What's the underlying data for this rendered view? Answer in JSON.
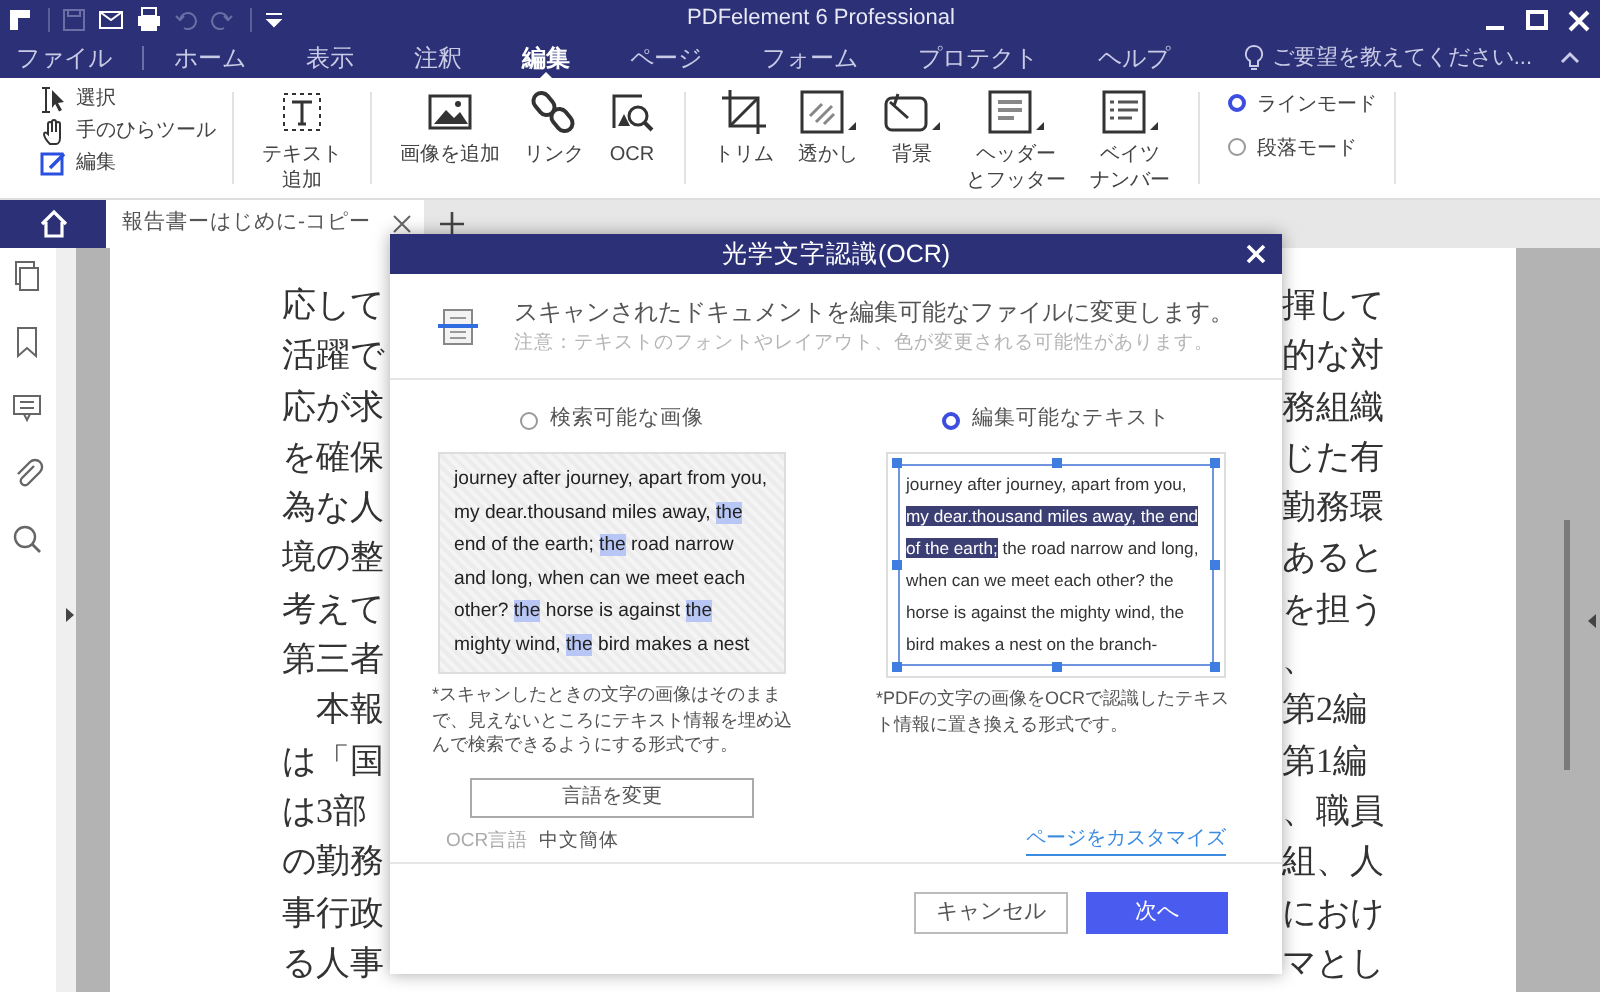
{
  "window": {
    "title": "PDFelement 6 Professional"
  },
  "quick_access": [
    {
      "kind": "logo",
      "disabled": false
    },
    {
      "kind": "save",
      "disabled": true
    },
    {
      "kind": "mail",
      "disabled": false
    },
    {
      "kind": "print",
      "disabled": false
    },
    {
      "kind": "undo",
      "disabled": true
    },
    {
      "kind": "redo",
      "disabled": true
    },
    {
      "kind": "customize",
      "disabled": false
    }
  ],
  "menu": {
    "tabs": [
      {
        "label": "ファイル",
        "selected": false
      },
      {
        "label": "ホーム",
        "selected": false
      },
      {
        "label": "表示",
        "selected": false
      },
      {
        "label": "注釈",
        "selected": false
      },
      {
        "label": "編集",
        "selected": true
      },
      {
        "label": "ページ",
        "selected": false
      },
      {
        "label": "フォーム",
        "selected": false
      },
      {
        "label": "プロテクト",
        "selected": false
      },
      {
        "label": "ヘルプ",
        "selected": false
      }
    ],
    "help_prompt": "ご要望を教えてください..."
  },
  "ribbon": {
    "select_tools": [
      {
        "label": "選択",
        "kind": "select"
      },
      {
        "label": "手のひらツール",
        "kind": "hand"
      },
      {
        "label": "編集",
        "kind": "edit"
      }
    ],
    "tools": [
      {
        "label_lines": [
          "テキスト",
          "追加"
        ],
        "kind": "text",
        "dropdown": false
      },
      {
        "label": "画像を追加",
        "kind": "image",
        "dropdown": false
      },
      {
        "label": "リンク",
        "kind": "link",
        "dropdown": false
      },
      {
        "label": "OCR",
        "kind": "ocr",
        "dropdown": false
      },
      {
        "label": "トリム",
        "kind": "crop",
        "dropdown": false
      },
      {
        "label": "透かし",
        "kind": "watermark",
        "dropdown": true
      },
      {
        "label": "背景",
        "kind": "background",
        "dropdown": true
      },
      {
        "label_lines": [
          "ヘッダー",
          "とフッター"
        ],
        "kind": "header",
        "dropdown": true
      },
      {
        "label_lines": [
          "ベイツ",
          "ナンバー"
        ],
        "kind": "bates",
        "dropdown": true
      }
    ],
    "modes": [
      {
        "label": "ラインモード",
        "selected": true
      },
      {
        "label": "段落モード",
        "selected": false
      }
    ]
  },
  "doc_tabs": [
    {
      "label": "報告書ーはじめに-コピー",
      "selected": true
    }
  ],
  "document": {
    "lines": [
      {
        "left": "応して",
        "right": "揮して"
      },
      {
        "left": "活躍で",
        "right": "的な対"
      },
      {
        "left": "応が求",
        "right": "務組織"
      },
      {
        "left": "を確保",
        "right": "じた有"
      },
      {
        "left": "為な人",
        "right": "勤務環"
      },
      {
        "left": "境の整",
        "right": "あると"
      },
      {
        "left": "考えて",
        "right": "を担う"
      },
      {
        "left": "第三者",
        "right": "、"
      },
      {
        "left": "本報",
        "right": "第2編"
      },
      {
        "left": "は「国",
        "right": "第1編"
      },
      {
        "left": "は3部",
        "right": "、職員"
      },
      {
        "left": "の勤務",
        "right": "組、人"
      },
      {
        "left": "事行政",
        "right": "におけ"
      },
      {
        "left": "る人事",
        "right": "マとし"
      }
    ]
  },
  "ocr_dialog": {
    "title": "光学文字認識(OCR)",
    "heading": "スキャンされたドキュメントを編集可能なファイルに変更します。",
    "note": "注意：テキストのフォントやレイアウト、色が変更される可能性があります。",
    "options": [
      {
        "label": "検索可能な画像",
        "selected": false,
        "kind": "searchable",
        "preview": [
          {
            "text": "journey after journey, apart from you, my dear.thousand miles away, ",
            "highlighted": false
          },
          {
            "text": "the",
            "highlighted": true
          },
          {
            "text": " end of the earth; ",
            "highlighted": false
          },
          {
            "text": "the",
            "highlighted": true
          },
          {
            "text": " road narrow and long, when can we meet each other? ",
            "highlighted": false
          },
          {
            "text": "the",
            "highlighted": true
          },
          {
            "text": " horse is against ",
            "highlighted": false
          },
          {
            "text": "the",
            "highlighted": true
          },
          {
            "text": " mighty wind, ",
            "highlighted": false
          },
          {
            "text": "the",
            "highlighted": true
          },
          {
            "text": " bird makes a nest",
            "highlighted": false
          }
        ],
        "description": "*スキャンしたときの文字の画像はそのままで、見えないところにテキスト情報を埋め込んで検索できるようにする形式です。"
      },
      {
        "label": "編集可能なテキスト",
        "selected": true,
        "kind": "editable",
        "preview": [
          {
            "text": "journey after journey, apart from you, ",
            "highlighted": false
          },
          {
            "text": "my dear.thousand miles away, the end of the earth;",
            "highlighted": true
          },
          {
            "text": " the road narrow and long, when can we meet each other? the horse is against the mighty wind, the bird makes a nest on the branch-",
            "highlighted": false
          }
        ],
        "description": "*PDFの文字の画像をOCRで認識したテキスト情報に置き換える形式です。"
      }
    ],
    "language_button": "言語を変更",
    "ocr_language_label": "OCR言語",
    "ocr_language": "中文簡体",
    "customize_link": "ページをカスタマイズ",
    "buttons": [
      {
        "label": "キャンセル",
        "kind": "secondary"
      },
      {
        "label": "次へ",
        "kind": "primary"
      }
    ]
  }
}
